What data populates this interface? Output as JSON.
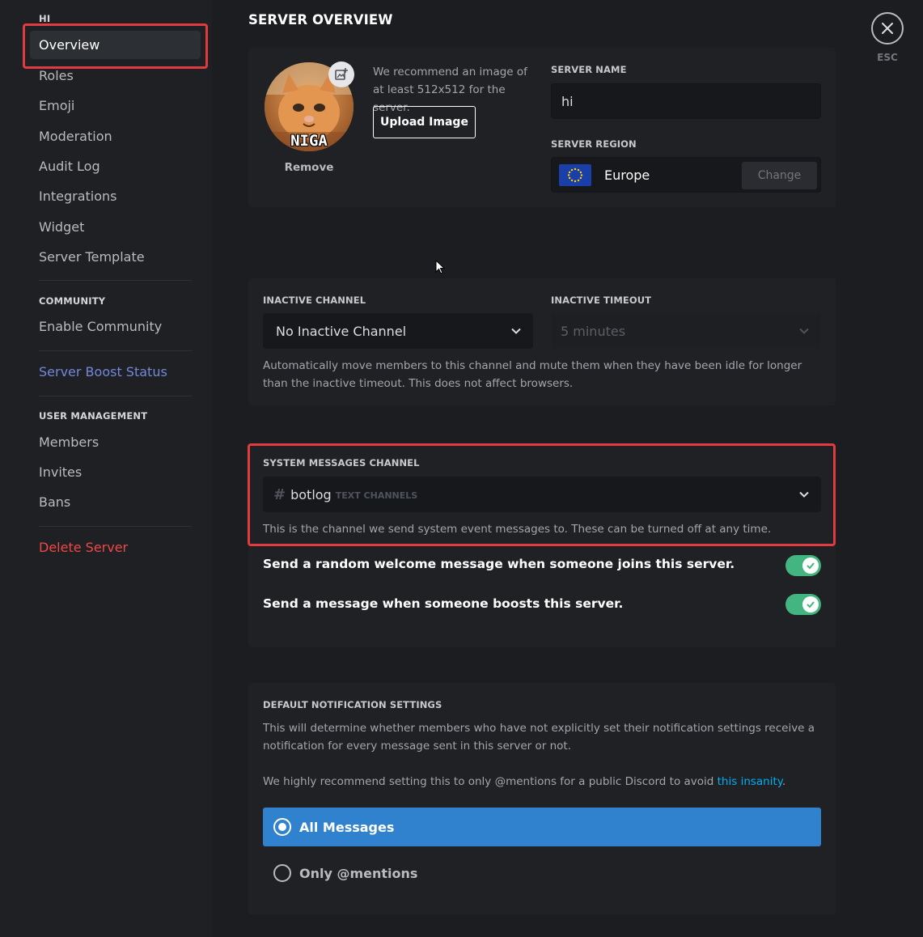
{
  "sidebar": {
    "server_heading": "HI",
    "items": [
      {
        "label": "Overview"
      },
      {
        "label": "Roles"
      },
      {
        "label": "Emoji"
      },
      {
        "label": "Moderation"
      },
      {
        "label": "Audit Log"
      },
      {
        "label": "Integrations"
      },
      {
        "label": "Widget"
      },
      {
        "label": "Server Template"
      }
    ],
    "community_heading": "COMMUNITY",
    "community_items": [
      {
        "label": "Enable Community"
      }
    ],
    "boost_label": "Server Boost Status",
    "user_management_heading": "USER MANAGEMENT",
    "user_items": [
      {
        "label": "Members"
      },
      {
        "label": "Invites"
      },
      {
        "label": "Bans"
      }
    ],
    "delete_label": "Delete Server"
  },
  "header": {
    "title": "SERVER OVERVIEW",
    "close_label": "ESC"
  },
  "overview": {
    "avatar_caption": "NIGA",
    "remove_label": "Remove",
    "recommend_text": "We recommend an image of at least 512x512 for the server.",
    "upload_label": "Upload Image",
    "server_name_label": "SERVER NAME",
    "server_name_value": "hi",
    "server_region_label": "SERVER REGION",
    "region_value": "Europe",
    "change_label": "Change"
  },
  "inactive": {
    "channel_label": "INACTIVE CHANNEL",
    "channel_value": "No Inactive Channel",
    "timeout_label": "INACTIVE TIMEOUT",
    "timeout_value": "5 minutes",
    "help": "Automatically move members to this channel and mute them when they have been idle for longer than the inactive timeout. This does not affect browsers."
  },
  "system": {
    "label": "SYSTEM MESSAGES CHANNEL",
    "channel_name": "botlog",
    "channel_category": "TEXT CHANNELS",
    "help": "This is the channel we send system event messages to. These can be turned off at any time.",
    "toggle_welcome": "Send a random welcome message when someone joins this server.",
    "toggle_boost": "Send a message when someone boosts this server.",
    "welcome_enabled": true,
    "boost_enabled": true
  },
  "notifications": {
    "label": "DEFAULT NOTIFICATION SETTINGS",
    "help1": "This will determine whether members who have not explicitly set their notification settings receive a notification for every message sent in this server or not.",
    "help2_prefix": "We highly recommend setting this to only @mentions for a public Discord to avoid ",
    "help2_link": "this insanity",
    "help2_suffix": ".",
    "options": [
      {
        "label": "All Messages",
        "selected": true
      },
      {
        "label": "Only @mentions",
        "selected": false
      }
    ]
  },
  "colors": {
    "accent": "#3182ce",
    "toggle_on": "#43b581",
    "danger": "#f04747",
    "link": "#00b0f4",
    "highlight": "#e03b3f"
  }
}
